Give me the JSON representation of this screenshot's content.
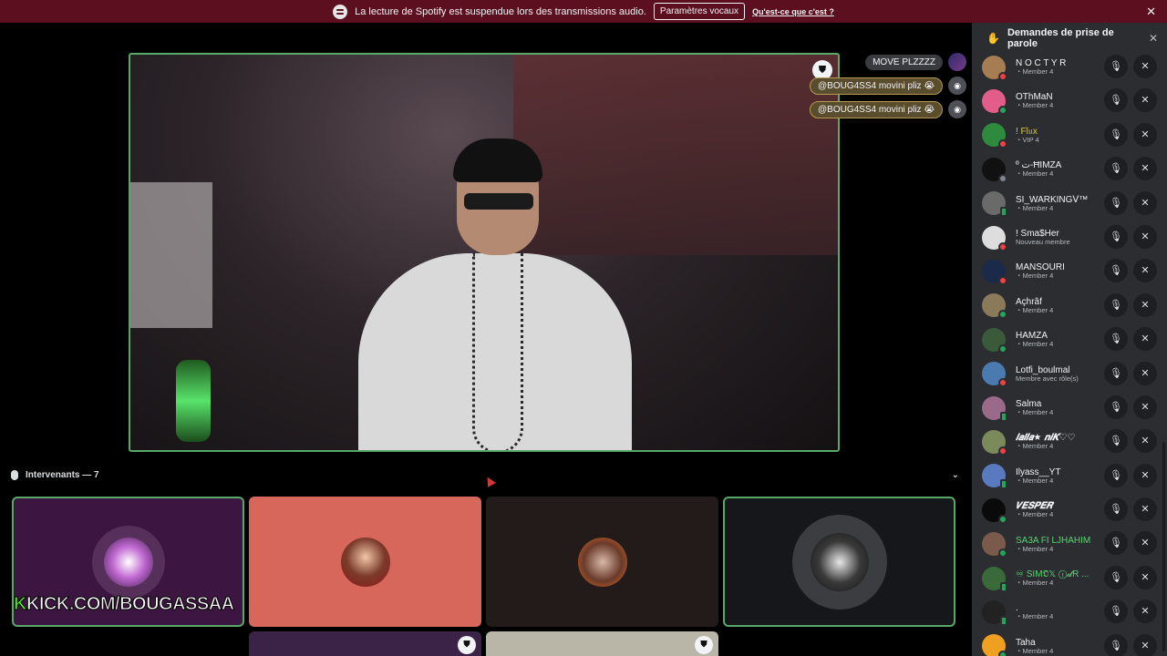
{
  "notice": {
    "text": "La lecture de Spotify est suspendue lors des transmissions audio.",
    "button": "Paramètres vocaux",
    "link": "Qu'est-ce que c'est ?",
    "close": "✕"
  },
  "stage": {
    "chat": [
      {
        "text": "MOVE PLZZZZ",
        "avatar": ""
      },
      {
        "text": "@BOUG4SS4  movini pliz 😭",
        "avatar": ""
      },
      {
        "text": "@BOUG4SS4  movini pliz 😭",
        "avatar": ""
      }
    ]
  },
  "speakers": {
    "label": "Intervenants — 7",
    "chevron": "⌄",
    "kick_prefix": "K",
    "kick_text": "KICK.COM/BOUGASSAA"
  },
  "panel": {
    "title": "Demandes de prise de parole",
    "close": "✕",
    "hand_icon": "✋",
    "invite_icon": "🎙",
    "deny_icon": "✕",
    "users": [
      {
        "name": "N O C T Y R",
        "role": "・Member 4",
        "style": "",
        "status": "dnd",
        "color": "#a67c52"
      },
      {
        "name": "OThMaN",
        "role": "・Member 4",
        "style": "",
        "status": "on",
        "color": "#e35d8a"
      },
      {
        "name": "! Fl𝔲x",
        "role": "・VIP 4",
        "style": "gold",
        "status": "dnd",
        "color": "#2e8b3e"
      },
      {
        "name": "º ت-ĦIMZA",
        "role": "・Member 4",
        "style": "",
        "status": "off",
        "color": "#111111"
      },
      {
        "name": "SI_WARKINGᐯ™",
        "role": "・Member 4",
        "style": "",
        "status": "mob",
        "color": "#6a6a6a"
      },
      {
        "name": "! Sma$Her",
        "role": "Nouveau membre",
        "style": "",
        "status": "dnd",
        "color": "#dddddd"
      },
      {
        "name": "MANSOURI",
        "role": "・Member 4",
        "style": "",
        "status": "dnd",
        "color": "#1c2a4a"
      },
      {
        "name": "Açhrâf",
        "role": "・Member 4",
        "style": "",
        "status": "on",
        "color": "#8a7a5a"
      },
      {
        "name": "HAMZA",
        "role": "・Member 4",
        "style": "",
        "status": "on",
        "color": "#3a5a3a"
      },
      {
        "name": "Lotfi_boulmal",
        "role": "Membre avec rôle(s)",
        "style": "",
        "status": "dnd",
        "color": "#4a7ab0"
      },
      {
        "name": "Salma",
        "role": "・Member 4",
        "style": "",
        "status": "mob",
        "color": "#9a6a8a"
      },
      {
        "name": "𝒍𝒂𝒍𝒍𝒂★ 𝒏𝒊𝑲♡♡",
        "role": "・Member 4",
        "style": "script",
        "status": "dnd",
        "color": "#7a8a5a"
      },
      {
        "name": "Ilyass__YT",
        "role": "・Member 4",
        "style": "",
        "status": "mob",
        "color": "#5a7ac0"
      },
      {
        "name": "𝑽𝑬𝑺𝑷𝑬𝑹",
        "role": "・Member 4",
        "style": "script",
        "status": "on",
        "color": "#0a0a0a"
      },
      {
        "name": "SA3A FI LJHAHIM",
        "role": "・Member 4",
        "style": "green",
        "status": "on",
        "color": "#7a5a4a"
      },
      {
        "name": "♾ SIM𝕺𝕏 ⓣ𝓭R ...",
        "role": "・Member 4",
        "style": "green",
        "status": "mob",
        "color": "#3a6a3a"
      },
      {
        "name": ".",
        "role": "・Member 4",
        "style": "",
        "status": "mob",
        "color": "#222222"
      },
      {
        "name": "Taha",
        "role": "・Member 4",
        "style": "",
        "status": "on",
        "color": "#f0a020"
      }
    ]
  }
}
